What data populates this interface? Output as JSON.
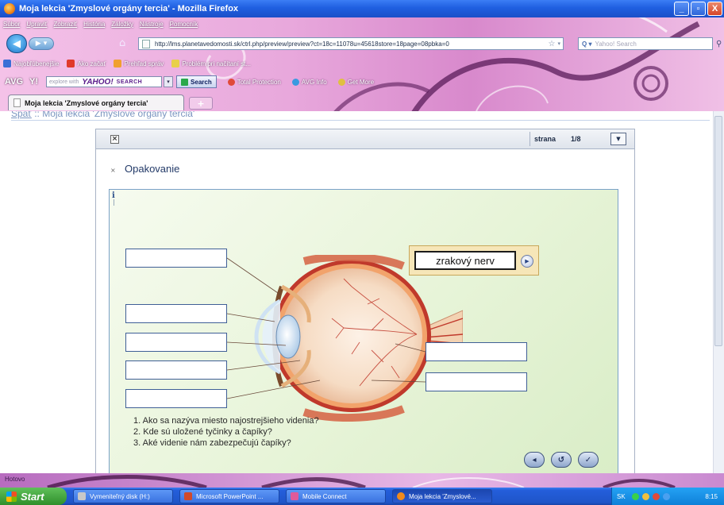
{
  "window": {
    "title": "Moja lekcia 'Zmyslové orgány tercia' - Mozilla Firefox",
    "btn_minimize": "_",
    "btn_maximize": "▫",
    "btn_close": "X"
  },
  "menu": [
    "Súbor",
    "Upraviť",
    "Zobraziť",
    "História",
    "Záložky",
    "Nástroje",
    "Pomocník"
  ],
  "nav": {
    "back_glyph": "◀",
    "forward_glyph": "▶ ▾",
    "home_glyph": "⌂",
    "url": "http://lms.planetavedomosti.sk/ctrl.php/preview/preview?ct=18c=11078u=45618store=18page=08pbka=0",
    "star": "☆",
    "dropdown": "▾",
    "search_engine": "Q ▾",
    "search_placeholder": "Yahoo! Search",
    "search_glyph": "⚲"
  },
  "bookmarks": [
    {
      "label": "Najobľúbenejšie",
      "color": "#3a6fd6"
    },
    {
      "label": "Ako začať",
      "color": "#e03a2a"
    },
    {
      "label": "Prehľad správ",
      "color": "#f0a030"
    },
    {
      "label": "Problém pri načítaní st...",
      "color": "#e8d04a"
    }
  ],
  "toolbar": {
    "avg_label": "AVG",
    "yahoo_y": "Y!",
    "yahoo_input_placeholder": "explore with",
    "yahoo_brand": "YAHOO!",
    "yahoo_search_word": "SEARCH",
    "search_button": "Search",
    "items": [
      {
        "label": "Total Protection",
        "color": "#e04a3a"
      },
      {
        "label": "AVG Info",
        "color": "#3a9ae0"
      },
      {
        "label": "Get More",
        "color": "#e0c040"
      }
    ]
  },
  "tabs": {
    "active_tab": "Moja lekcia 'Zmyslové orgány tercia'",
    "new_tab": "+"
  },
  "breadcrumb": {
    "back": "Späť",
    "separator": " :: ",
    "current": "Moja lekcia 'Zmyslové orgány tercia'"
  },
  "lesson": {
    "close": "×",
    "page_label": "strana",
    "page_value": "1/8",
    "page_dropdown": "▼",
    "section_close": "×",
    "section_title": "Opakovanie",
    "info_glyph": "i",
    "answer_label": "zrakový nerv",
    "answer_play": "▶",
    "questions": [
      "1. Ako sa nazýva miesto najostrejšieho videnia?",
      "2. Kde sú uložené tyčinky a čapíky?",
      "3. Aké videnie nám zabezpečujú čapíky?"
    ],
    "controls": {
      "prev": "◂",
      "reset": "↺",
      "check": "✓"
    }
  },
  "status": {
    "text": "Hotovo"
  },
  "taskbar": {
    "start": "Start",
    "items": [
      {
        "label": "Vymeniteľný disk (H:)",
        "color": "#c8c8c8",
        "active": false
      },
      {
        "label": "Microsoft PowerPoint ...",
        "color": "#d04a2a",
        "active": false
      },
      {
        "label": "Mobile Connect",
        "color": "#e05a9a",
        "active": false
      },
      {
        "label": "Moja lekcia 'Zmyslové...",
        "color": "#f08a1c",
        "active": true
      }
    ],
    "lang": "SK",
    "tray_icons": [
      "#3ad04a",
      "#f0c040",
      "#e04a3a",
      "#4aa0f0"
    ],
    "clock": "8:15"
  },
  "colors": {
    "accent_blue": "#1f5fe0",
    "label_box_border": "#3f5f96",
    "panel_border": "#7aa2c8",
    "answer_chip": "#f6e6b8"
  }
}
